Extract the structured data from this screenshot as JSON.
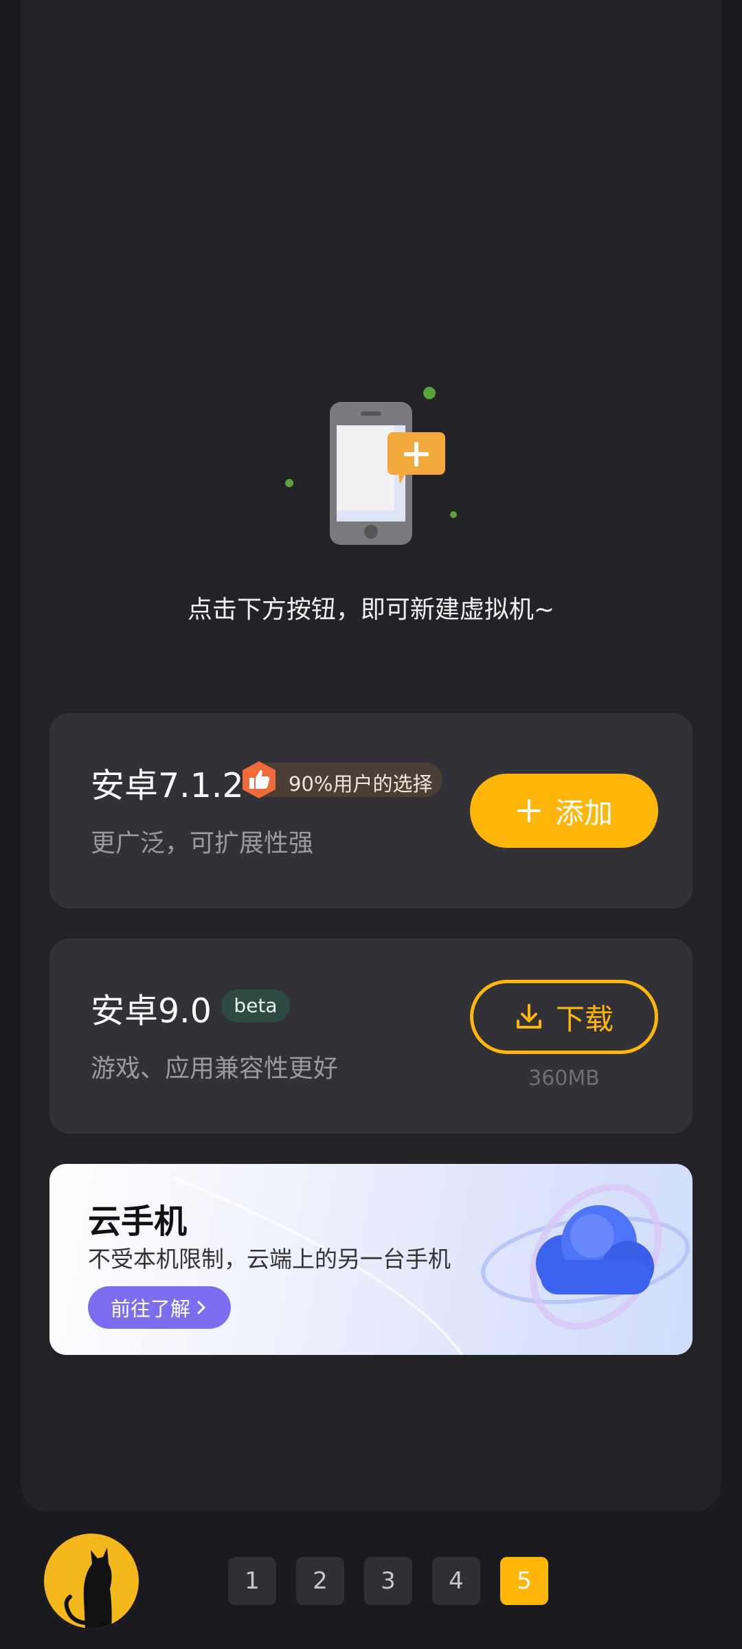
{
  "empty_state": {
    "hint": "点击下方按钮，即可新建虚拟机~"
  },
  "cards": [
    {
      "title": "安卓7.1.2",
      "badge": "90%用户的选择",
      "description": "更广泛，可扩展性强",
      "action_label": "添加"
    },
    {
      "title": "安卓9.0",
      "badge": "beta",
      "description": "游戏、应用兼容性更好",
      "action_label": "下载",
      "size": "360MB"
    }
  ],
  "banner": {
    "title": "云手机",
    "subtitle": "不受本机限制，云端上的另一台手机",
    "button_label": "前往了解"
  },
  "pagination": {
    "pages": [
      "1",
      "2",
      "3",
      "4",
      "5"
    ],
    "active_page": "5"
  },
  "colors": {
    "accent": "#ffb60a",
    "background": "#1b1b1f",
    "panel": "#222227",
    "card": "#313137",
    "banner_button": "#7b6ef0"
  }
}
